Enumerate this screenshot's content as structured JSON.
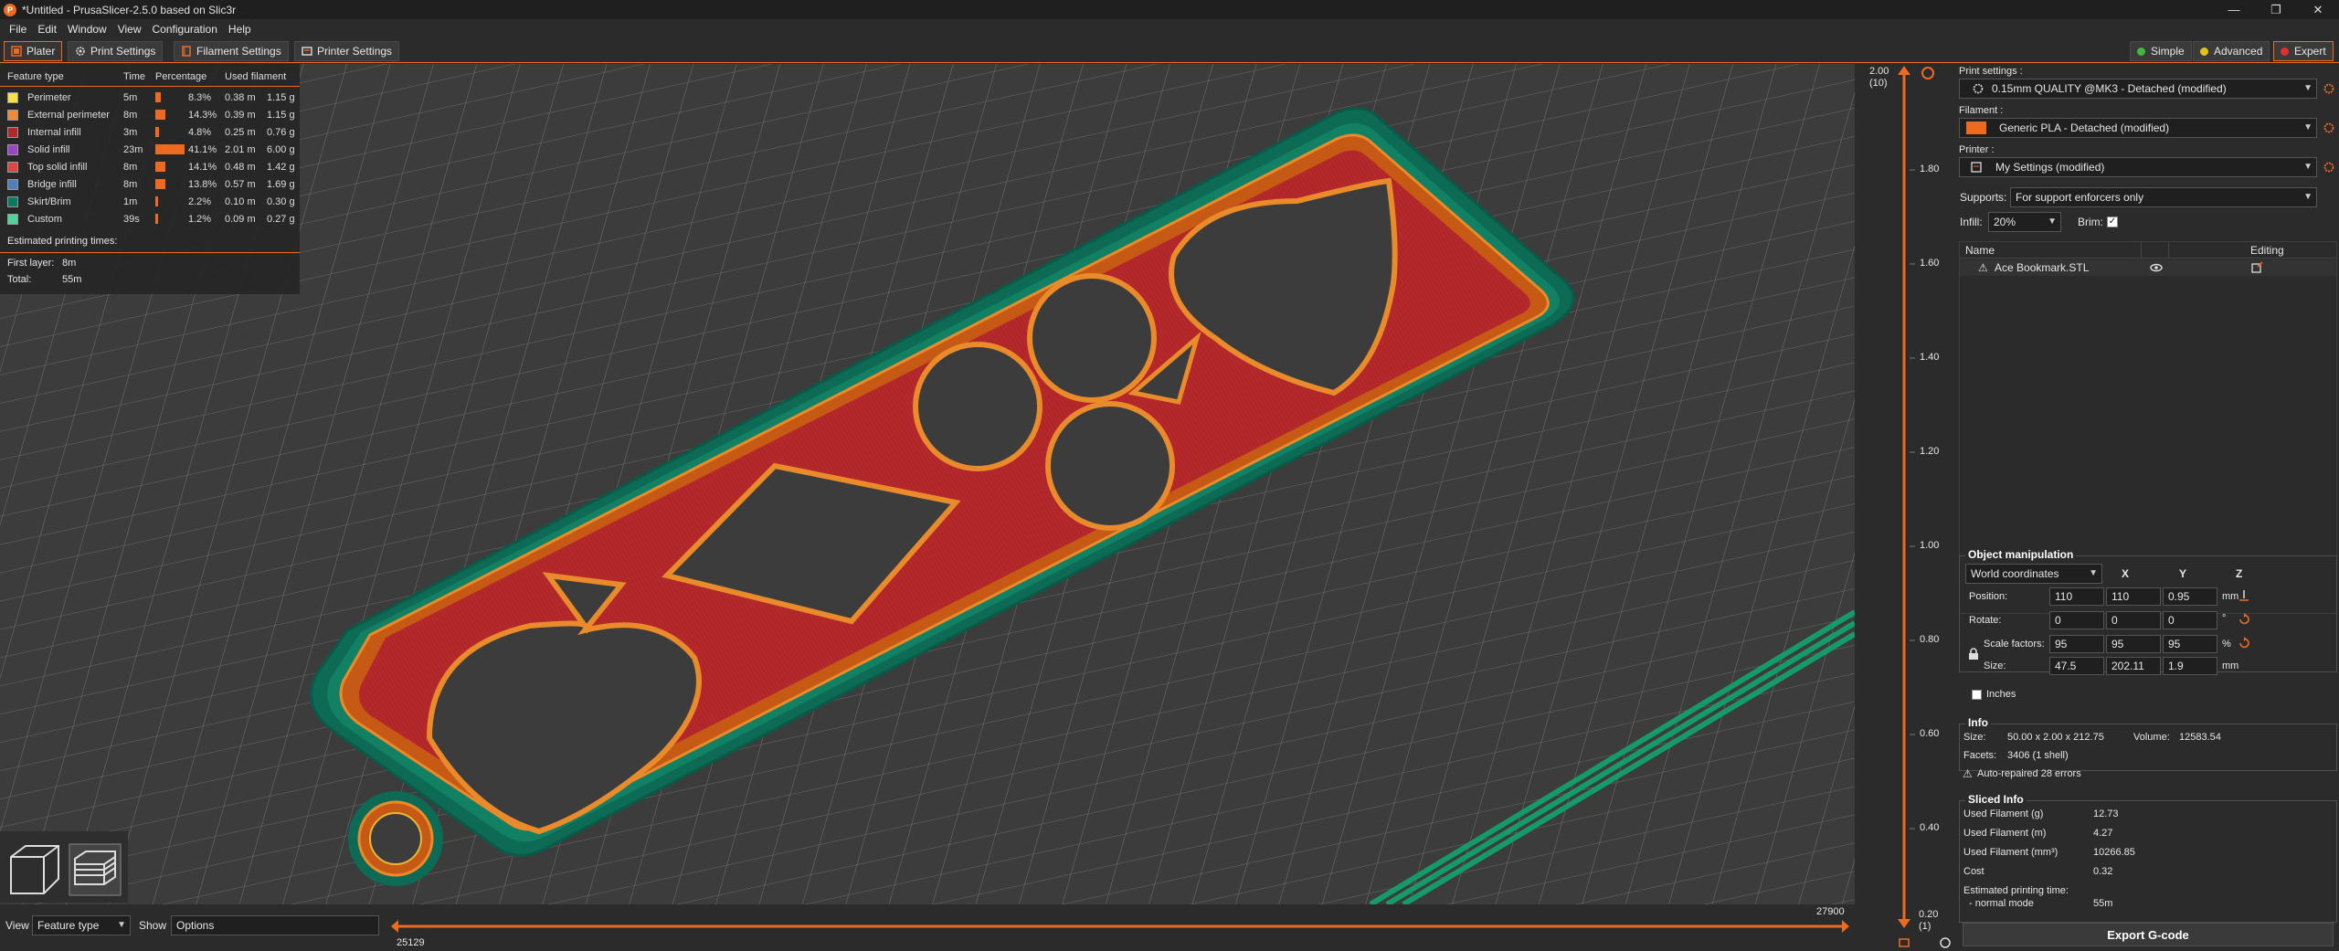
{
  "window": {
    "title": "*Untitled - PrusaSlicer-2.5.0 based on Slic3r",
    "min": "—",
    "max": "❐",
    "close": "✕"
  },
  "menu": [
    "File",
    "Edit",
    "Window",
    "View",
    "Configuration",
    "Help"
  ],
  "tabs": [
    "Plater",
    "Print Settings",
    "Filament Settings",
    "Printer Settings"
  ],
  "modes": [
    {
      "label": "Simple",
      "color": "#3fba3f"
    },
    {
      "label": "Advanced",
      "color": "#e3c21b"
    },
    {
      "label": "Expert",
      "color": "#e03030"
    }
  ],
  "legend": {
    "headers": [
      "Feature type",
      "Time",
      "Percentage",
      "Used filament"
    ],
    "rows": [
      {
        "name": "Perimeter",
        "time": "5m",
        "pct": "8.3%",
        "pct_value": 8.3,
        "len": "0.38 m",
        "weight": "1.15 g",
        "color": "#f5e142"
      },
      {
        "name": "External perimeter",
        "time": "8m",
        "pct": "14.3%",
        "pct_value": 14.3,
        "len": "0.39 m",
        "weight": "1.15 g",
        "color": "#f08a3a"
      },
      {
        "name": "Internal infill",
        "time": "3m",
        "pct": "4.8%",
        "pct_value": 4.8,
        "len": "0.25 m",
        "weight": "0.76 g",
        "color": "#b02a2a"
      },
      {
        "name": "Solid infill",
        "time": "23m",
        "pct": "41.1%",
        "pct_value": 41.1,
        "len": "2.01 m",
        "weight": "6.00 g",
        "color": "#9a44c8"
      },
      {
        "name": "Top solid infill",
        "time": "8m",
        "pct": "14.1%",
        "pct_value": 14.1,
        "len": "0.48 m",
        "weight": "1.42 g",
        "color": "#e04545"
      },
      {
        "name": "Bridge infill",
        "time": "8m",
        "pct": "13.8%",
        "pct_value": 13.8,
        "len": "0.57 m",
        "weight": "1.69 g",
        "color": "#4f7fbf"
      },
      {
        "name": "Skirt/Brim",
        "time": "1m",
        "pct": "2.2%",
        "pct_value": 2.2,
        "len": "0.10 m",
        "weight": "0.30 g",
        "color": "#0c7a60"
      },
      {
        "name": "Custom",
        "time": "39s",
        "pct": "1.2%",
        "pct_value": 1.2,
        "len": "0.09 m",
        "weight": "0.27 g",
        "color": "#4fd39a"
      }
    ],
    "est_title": "Estimated printing times:",
    "first_layer_label": "First layer:",
    "first_layer": "8m",
    "total_label": "Total:",
    "total": "55m"
  },
  "vslider": {
    "top_value": "2.00",
    "top_layer": "(10)",
    "ticks": [
      "1.80",
      "1.60",
      "1.40",
      "1.20",
      "1.00",
      "0.80",
      "0.60",
      "0.40"
    ],
    "bottom_value": "0.20",
    "bottom_layer": "(1)"
  },
  "hslider": {
    "right_value": "27900",
    "left_value": "25129"
  },
  "bottom": {
    "view_label": "View",
    "view_value": "Feature type",
    "show_label": "Show",
    "show_value": "Options"
  },
  "sidebar": {
    "print_label": "Print settings :",
    "print_value": "0.15mm QUALITY @MK3 - Detached (modified)",
    "filament_label": "Filament :",
    "filament_value": "Generic PLA - Detached (modified)",
    "filament_color": "#ed6b21",
    "printer_label": "Printer :",
    "printer_value": "My Settings (modified)",
    "supports_label": "Supports:",
    "supports_value": "For support enforcers only",
    "infill_label": "Infill:",
    "infill_value": "20%",
    "brim_label": "Brim:",
    "list_headers": [
      "Name",
      "Editing"
    ],
    "object_name": "Ace Bookmark.STL"
  },
  "manip": {
    "title": "Object manipulation",
    "coords": "World coordinates",
    "axes": [
      "X",
      "Y",
      "Z"
    ],
    "position_label": "Position:",
    "position": [
      "110",
      "110",
      "0.95"
    ],
    "position_unit": "mm",
    "rotate_label": "Rotate:",
    "rotate": [
      "0",
      "0",
      "0"
    ],
    "rotate_unit": "°",
    "scale_label": "Scale factors:",
    "scale": [
      "95",
      "95",
      "95"
    ],
    "scale_unit": "%",
    "size_label": "Size:",
    "size": [
      "47.5",
      "202.11",
      "1.9"
    ],
    "size_unit": "mm",
    "inches_label": "Inches"
  },
  "info": {
    "title": "Info",
    "size_label": "Size:",
    "size": "50.00 x 2.00 x 212.75",
    "volume_label": "Volume:",
    "volume": "12583.54",
    "facets_label": "Facets:",
    "facets": "3406 (1 shell)",
    "warning": "Auto-repaired 28 errors"
  },
  "sliced": {
    "title": "Sliced Info",
    "rows": [
      {
        "label": "Used Filament (g)",
        "value": "12.73"
      },
      {
        "label": "Used Filament (m)",
        "value": "4.27"
      },
      {
        "label": "Used Filament (mm³)",
        "value": "10266.85"
      },
      {
        "label": "Cost",
        "value": "0.32"
      }
    ],
    "est_label": "Estimated printing time:",
    "mode_label": "- normal mode",
    "mode_value": "55m"
  },
  "export_label": "Export G-code"
}
